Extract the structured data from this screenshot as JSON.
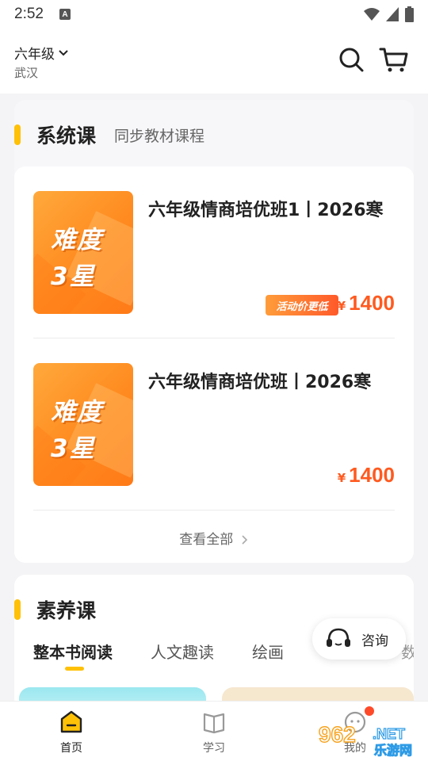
{
  "status_bar": {
    "time": "2:52",
    "notif_letter": "A"
  },
  "header": {
    "grade": "六年级",
    "city": "武汉"
  },
  "system_section": {
    "title": "系统课",
    "subtitle": "同步教材课程",
    "courses": [
      {
        "thumb_line1": "难度",
        "thumb_line2": "3星",
        "title": "六年级情商培优班1丨2026寒",
        "promo": "活动价更低",
        "currency": "¥",
        "price": "1400"
      },
      {
        "thumb_line1": "难度",
        "thumb_line2": "3星",
        "title": "六年级情商培优班丨2026寒",
        "currency": "¥",
        "price": "1400"
      }
    ],
    "view_all": "查看全部"
  },
  "quality_section": {
    "title": "素养课",
    "tabs": [
      "整本书阅读",
      "人文趣读",
      "绘画"
    ],
    "tab_more": "数"
  },
  "consult_button": {
    "label": "咨询"
  },
  "bottom_nav": [
    {
      "label": "首页",
      "icon": "home-icon",
      "active": true
    },
    {
      "label": "学习",
      "icon": "book-icon",
      "active": false
    },
    {
      "label": "我的",
      "icon": "profile-icon",
      "active": false
    }
  ],
  "watermark": {
    "text1": "962",
    "text2": ".NET",
    "text3": "乐游网"
  },
  "colors": {
    "accent": "#ffc107",
    "price": "#ff5a1f",
    "thumb": "#ff8a1f"
  }
}
